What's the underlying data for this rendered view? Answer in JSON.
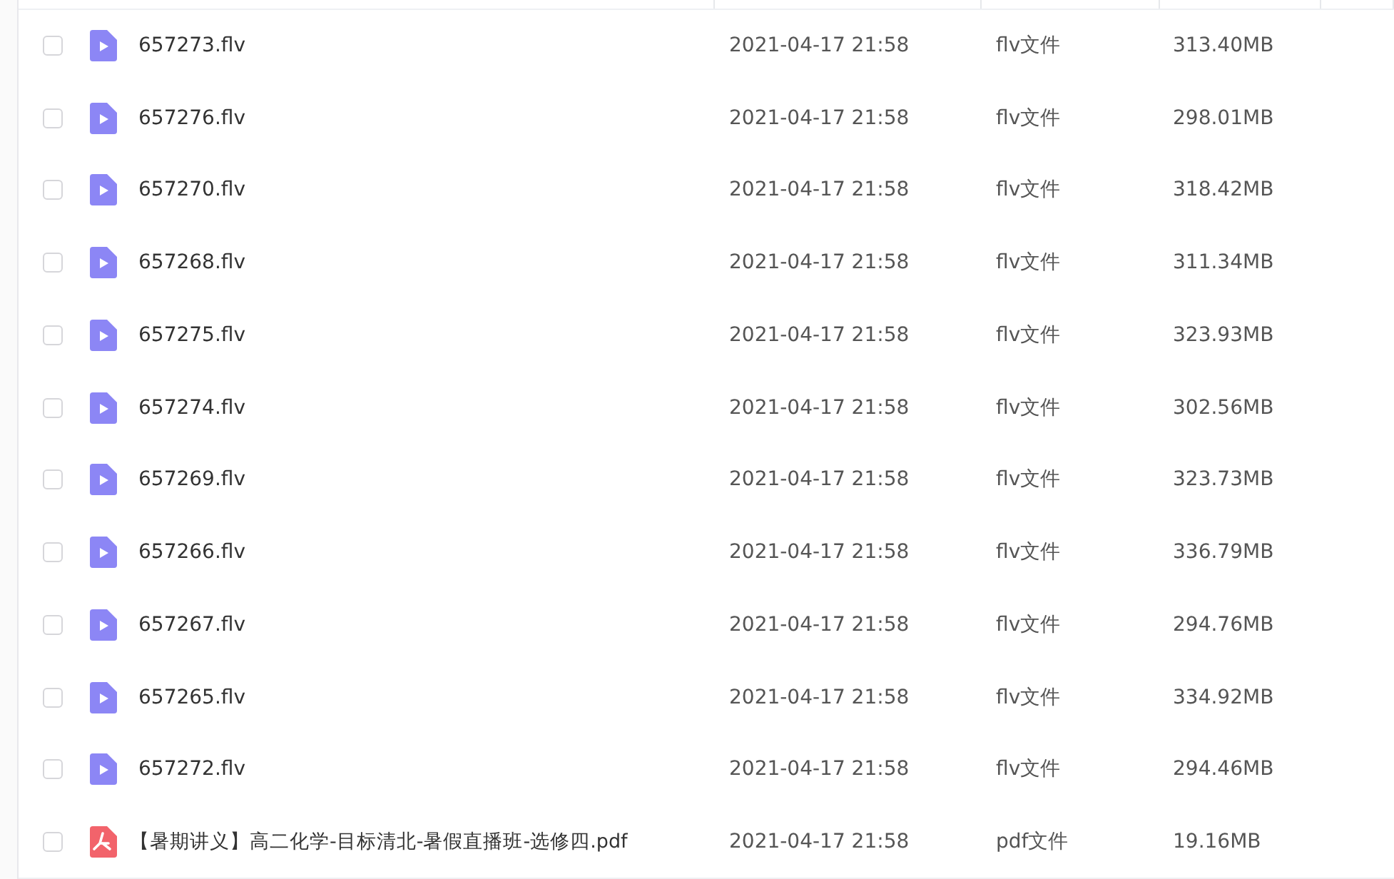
{
  "files": [
    {
      "kind": "video",
      "name": "657273.flv",
      "date": "2021-04-17 21:58",
      "type": "flv文件",
      "size": "313.40MB",
      "checked": false
    },
    {
      "kind": "video",
      "name": "657276.flv",
      "date": "2021-04-17 21:58",
      "type": "flv文件",
      "size": "298.01MB",
      "checked": false
    },
    {
      "kind": "video",
      "name": "657270.flv",
      "date": "2021-04-17 21:58",
      "type": "flv文件",
      "size": "318.42MB",
      "checked": false
    },
    {
      "kind": "video",
      "name": "657268.flv",
      "date": "2021-04-17 21:58",
      "type": "flv文件",
      "size": "311.34MB",
      "checked": false
    },
    {
      "kind": "video",
      "name": "657275.flv",
      "date": "2021-04-17 21:58",
      "type": "flv文件",
      "size": "323.93MB",
      "checked": false
    },
    {
      "kind": "video",
      "name": "657274.flv",
      "date": "2021-04-17 21:58",
      "type": "flv文件",
      "size": "302.56MB",
      "checked": false
    },
    {
      "kind": "video",
      "name": "657269.flv",
      "date": "2021-04-17 21:58",
      "type": "flv文件",
      "size": "323.73MB",
      "checked": false
    },
    {
      "kind": "video",
      "name": "657266.flv",
      "date": "2021-04-17 21:58",
      "type": "flv文件",
      "size": "336.79MB",
      "checked": false
    },
    {
      "kind": "video",
      "name": "657267.flv",
      "date": "2021-04-17 21:58",
      "type": "flv文件",
      "size": "294.76MB",
      "checked": false
    },
    {
      "kind": "video",
      "name": "657265.flv",
      "date": "2021-04-17 21:58",
      "type": "flv文件",
      "size": "334.92MB",
      "checked": false
    },
    {
      "kind": "video",
      "name": "657272.flv",
      "date": "2021-04-17 21:58",
      "type": "flv文件",
      "size": "294.46MB",
      "checked": false
    },
    {
      "kind": "pdf",
      "name": "【暑期讲义】高二化学-目标清北-暑假直播班-选修四.pdf",
      "date": "2021-04-17 21:58",
      "type": "pdf文件",
      "size": "19.16MB",
      "checked": false
    }
  ]
}
